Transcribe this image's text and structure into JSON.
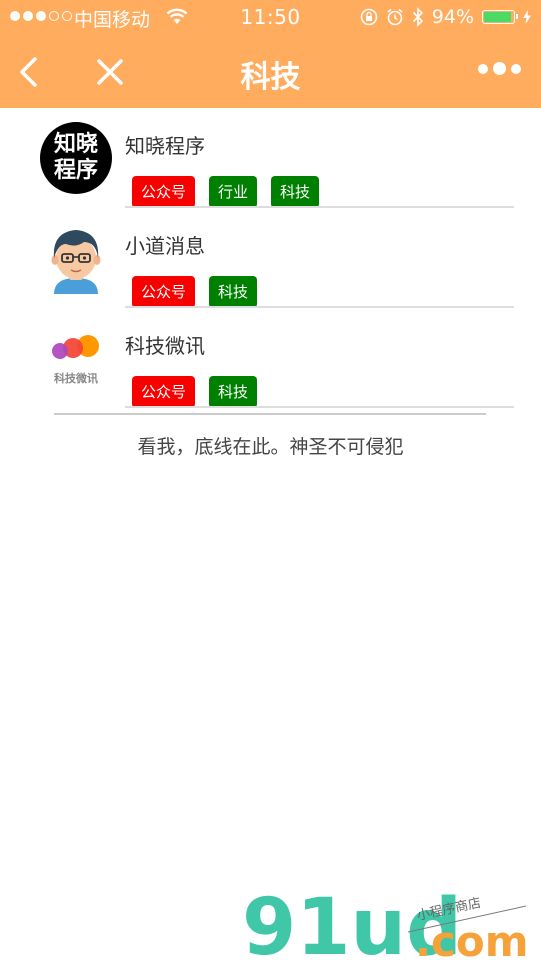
{
  "status_bar": {
    "carrier": "中国移动",
    "time": "11:50",
    "battery": "94%",
    "battery_level": 0.94,
    "signal_bars_filled": 3,
    "signal_bars_total": 5
  },
  "nav": {
    "title": "科技",
    "back_icon": "chevron-left-icon",
    "close_icon": "close-icon",
    "more_icon": "more-dots-icon"
  },
  "items": [
    {
      "name": "知晓程序",
      "avatar_text": "知晓程序",
      "tags": [
        {
          "label": "公众号",
          "color": "#f90000"
        },
        {
          "label": "行业",
          "color": "#008000"
        },
        {
          "label": "科技",
          "color": "#008000"
        }
      ]
    },
    {
      "name": "小道消息",
      "tags": [
        {
          "label": "公众号",
          "color": "#f90000"
        },
        {
          "label": "科技",
          "color": "#008000"
        }
      ]
    },
    {
      "name": "科技微讯",
      "avatar_text": "科技微讯",
      "tags": [
        {
          "label": "公众号",
          "color": "#f90000"
        },
        {
          "label": "科技",
          "color": "#008000"
        }
      ]
    }
  ],
  "footer": {
    "baseline_text": "看我，底线在此。神圣不可侵犯"
  },
  "watermark": {
    "logo_text": "91ud",
    "domain_text": ".com",
    "tagline": "小程序商店"
  },
  "colors": {
    "header_bg": "#ffac5f",
    "tag_red": "#f90000",
    "tag_green": "#008000",
    "battery_fill": "#4cd964"
  }
}
